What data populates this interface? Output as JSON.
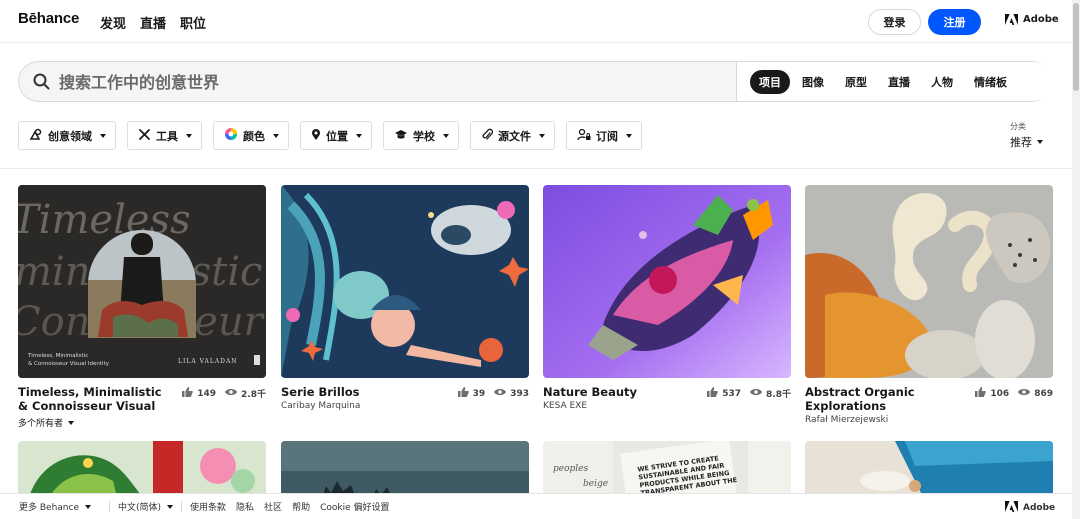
{
  "header": {
    "logo": "Bēhance",
    "nav": [
      "发现",
      "直播",
      "职位"
    ],
    "login_label": "登录",
    "signup_label": "注册",
    "adobe_label": "Adobe"
  },
  "search": {
    "placeholder": "搜索工作中的创意世界",
    "tabs": [
      "项目",
      "图像",
      "原型",
      "直播",
      "人物",
      "情绪板"
    ],
    "active_tab": "项目"
  },
  "filters": [
    "创意领域",
    "工具",
    "颜色",
    "位置",
    "学校",
    "源文件",
    "订阅"
  ],
  "sort": {
    "label": "分类",
    "value": "推荐"
  },
  "cards": [
    {
      "title": "Timeless, Minimalistic & Connoisseur Visual",
      "owner": "多个所有者",
      "likes": "149",
      "views": "2.8千",
      "thumb_text": "Timeless, Minimalistic & Connoisseur Visual Identity",
      "thumb_brand": "LILA VALADAN"
    },
    {
      "title": "Serie Brillos",
      "owner": "Caribay Marquina",
      "likes": "39",
      "views": "393"
    },
    {
      "title": "Nature Beauty",
      "owner": "KESA EXE",
      "likes": "537",
      "views": "8.8千"
    },
    {
      "title": "Abstract Organic Explorations",
      "owner": "Rafał Mierzejewski",
      "likes": "106",
      "views": "869"
    }
  ],
  "row2_thumb_text": "WE STRIVE TO CREATE SUSTAINABLE AND FAIR PRODUCTS WHILE BEING TRANSPARENT ABOUT THE MATERIALS AND PROCESS",
  "footer": {
    "more": "更多 Behance",
    "language": "中文(简体)",
    "links": [
      "使用条款",
      "隐私",
      "社区",
      "帮助",
      "Cookie 偏好设置"
    ],
    "adobe_label": "Adobe"
  },
  "colors": {
    "accent": "#0057ff",
    "text": "#191919"
  }
}
